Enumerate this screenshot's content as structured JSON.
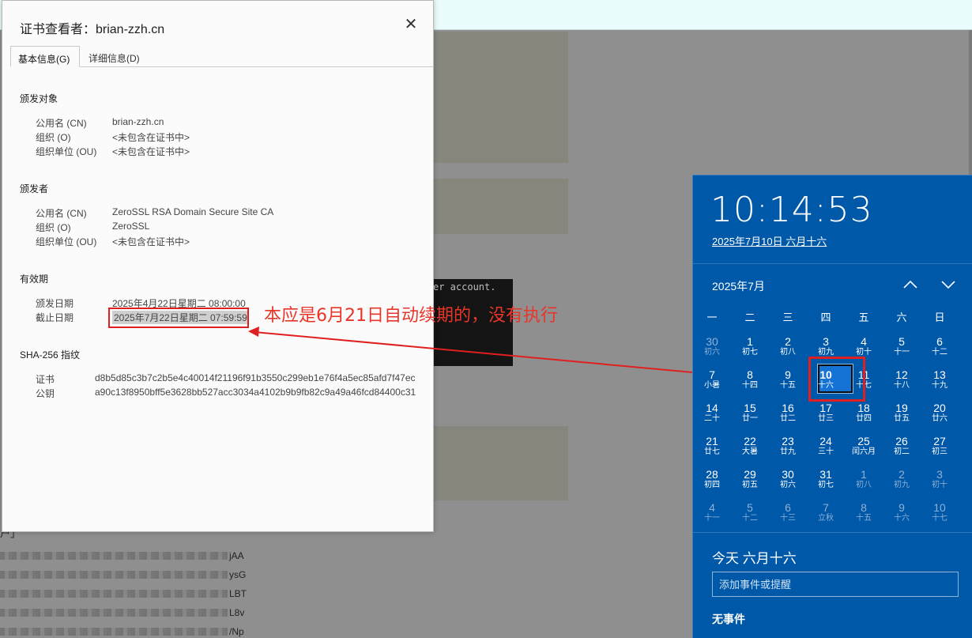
{
  "background": {
    "terminal_text": "er account.",
    "fragment_left": "户」",
    "blurred_suffixes": [
      "jAA",
      "ysG",
      "LBT",
      "L8v",
      "/Np"
    ]
  },
  "cert_viewer": {
    "title": "证书查看者：brian-zzh.cn",
    "tabs": [
      {
        "label": "基本信息(G)"
      },
      {
        "label": "详细信息(D)"
      }
    ],
    "issued_to": {
      "heading": "颁发对象",
      "rows": [
        {
          "label": "公用名 (CN)",
          "value": "brian-zzh.cn"
        },
        {
          "label": "组织 (O)",
          "value": "<未包含在证书中>"
        },
        {
          "label": "组织单位 (OU)",
          "value": "<未包含在证书中>"
        }
      ]
    },
    "issued_by": {
      "heading": "颁发者",
      "rows": [
        {
          "label": "公用名 (CN)",
          "value": "ZeroSSL RSA Domain Secure Site CA"
        },
        {
          "label": "组织 (O)",
          "value": "ZeroSSL"
        },
        {
          "label": "组织单位 (OU)",
          "value": "<未包含在证书中>"
        }
      ]
    },
    "validity": {
      "heading": "有效期",
      "issued_label": "颁发日期",
      "issued_value": "2025年4月22日星期二 08:00:00",
      "expiry_label": "截止日期",
      "expiry_value": "2025年7月22日星期二 07:59:59"
    },
    "fingerprints": {
      "heading": "SHA-256 指纹",
      "cert_label": "证书",
      "cert_value": "d8b5d85c3b7c2b5e4c40014f21196f91b3550c299eb1e76f4a5ec85afd7f47ec",
      "key_label": "公钥",
      "key_value": "a90c13f8950bff5e3628bb527acc3034a4102b9b9fb82c9a49a46fcd84400c31"
    },
    "close_icon": "close-icon"
  },
  "annotation": {
    "text": "本应是6月21日自动续期的，没有执行",
    "color": "#e8352a"
  },
  "clock": {
    "time": "10:14:53",
    "date_link": "2025年7月10日 六月十六",
    "month_label": "2025年7月",
    "nav_up_icon": "chevron-up-icon",
    "nav_down_icon": "chevron-down-icon",
    "weekdays": [
      "一",
      "二",
      "三",
      "四",
      "五",
      "六",
      "日"
    ],
    "days": [
      {
        "n": "30",
        "l": "初六",
        "dim": true
      },
      {
        "n": "1",
        "l": "初七"
      },
      {
        "n": "2",
        "l": "初八"
      },
      {
        "n": "3",
        "l": "初九"
      },
      {
        "n": "4",
        "l": "初十"
      },
      {
        "n": "5",
        "l": "十一"
      },
      {
        "n": "6",
        "l": "十二"
      },
      {
        "n": "7",
        "l": "小暑"
      },
      {
        "n": "8",
        "l": "十四"
      },
      {
        "n": "9",
        "l": "十五"
      },
      {
        "n": "10",
        "l": "十六",
        "today": true
      },
      {
        "n": "11",
        "l": "十七"
      },
      {
        "n": "12",
        "l": "十八"
      },
      {
        "n": "13",
        "l": "十九"
      },
      {
        "n": "14",
        "l": "二十"
      },
      {
        "n": "15",
        "l": "廿一"
      },
      {
        "n": "16",
        "l": "廿二"
      },
      {
        "n": "17",
        "l": "廿三"
      },
      {
        "n": "18",
        "l": "廿四"
      },
      {
        "n": "19",
        "l": "廿五"
      },
      {
        "n": "20",
        "l": "廿六"
      },
      {
        "n": "21",
        "l": "廿七"
      },
      {
        "n": "22",
        "l": "大暑"
      },
      {
        "n": "23",
        "l": "廿九"
      },
      {
        "n": "24",
        "l": "三十"
      },
      {
        "n": "25",
        "l": "闰六月"
      },
      {
        "n": "26",
        "l": "初二"
      },
      {
        "n": "27",
        "l": "初三"
      },
      {
        "n": "28",
        "l": "初四"
      },
      {
        "n": "29",
        "l": "初五"
      },
      {
        "n": "30",
        "l": "初六"
      },
      {
        "n": "31",
        "l": "初七"
      },
      {
        "n": "1",
        "l": "初八",
        "dim": true
      },
      {
        "n": "2",
        "l": "初九",
        "dim": true
      },
      {
        "n": "3",
        "l": "初十",
        "dim": true
      },
      {
        "n": "4",
        "l": "十一",
        "dim": true
      },
      {
        "n": "5",
        "l": "十二",
        "dim": true
      },
      {
        "n": "6",
        "l": "十三",
        "dim": true
      },
      {
        "n": "7",
        "l": "立秋",
        "dim": true
      },
      {
        "n": "8",
        "l": "十五",
        "dim": true
      },
      {
        "n": "9",
        "l": "十六",
        "dim": true
      },
      {
        "n": "10",
        "l": "十七",
        "dim": true
      }
    ],
    "agenda_title": "今天 六月十六",
    "event_placeholder": "添加事件或提醒",
    "no_events": "无事件"
  }
}
